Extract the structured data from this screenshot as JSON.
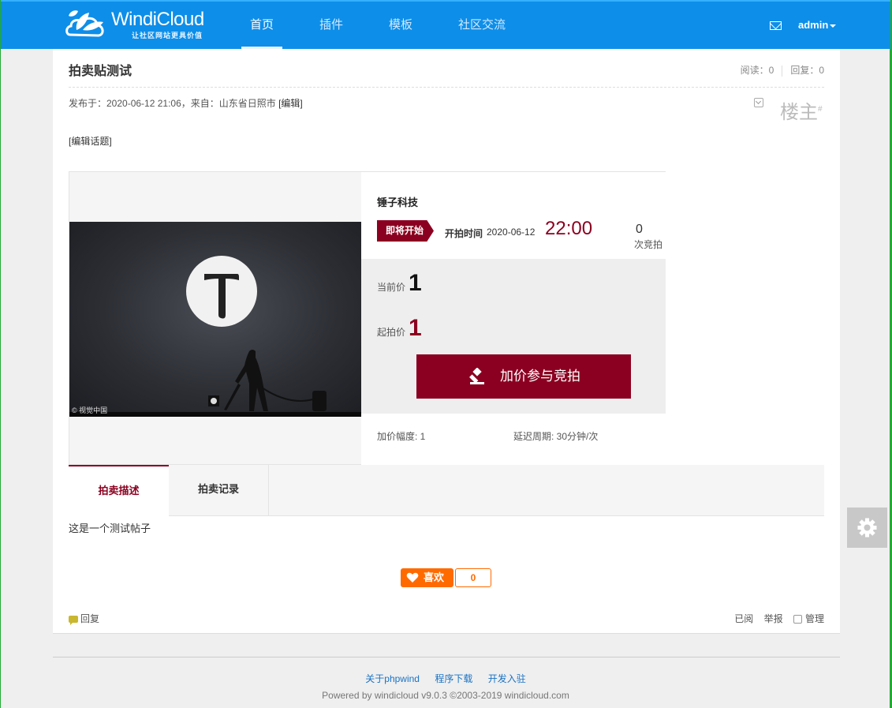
{
  "header": {
    "logo_name": "WindiCloud",
    "logo_slogan": "让社区网站更具价值",
    "nav": [
      "首页",
      "插件",
      "模板",
      "社区交流"
    ],
    "active_nav": "首页",
    "user": "admin",
    "accent_color": "#0d8ee9"
  },
  "post": {
    "title": "拍卖贴测试",
    "views": "阅读：0",
    "replies": "回复：0",
    "meta_prefix": "发布于：2020-06-12 21:06，来自：山东省日照市 ",
    "edit_link": "[编辑]",
    "floor": "楼主",
    "floor_mark": "#",
    "edit_topic": "[编辑话题]"
  },
  "auction": {
    "image_credit": "© 视觉中国",
    "brand": "锤子科技",
    "status": "即将开始",
    "start_label": "开拍时间",
    "start_date": "2020-06-12",
    "start_time": "22:00",
    "bid_count": "0",
    "bid_unit": "次竞拍",
    "current_price_label": "当前价",
    "current_price": "1",
    "start_price_label": "起拍价",
    "start_price": "1",
    "bid_button": "加价参与竞拍",
    "increment": "加价幅度: 1",
    "delay": "延迟周期: 30分钟/次",
    "accent_color": "#8b0020"
  },
  "tabs": [
    "拍卖描述",
    "拍卖记录"
  ],
  "description": "这是一个测试帖子",
  "like": {
    "label": "喜欢",
    "count": "0"
  },
  "bottom": {
    "reply": "回复",
    "read": "已阅",
    "report": "举报",
    "manage": "管理"
  },
  "footer": {
    "links": [
      "关于phpwind",
      "程序下载",
      "开发入驻"
    ],
    "copyright": "Powered by windicloud v9.0.3 ©2003-2019 windicloud.com"
  }
}
